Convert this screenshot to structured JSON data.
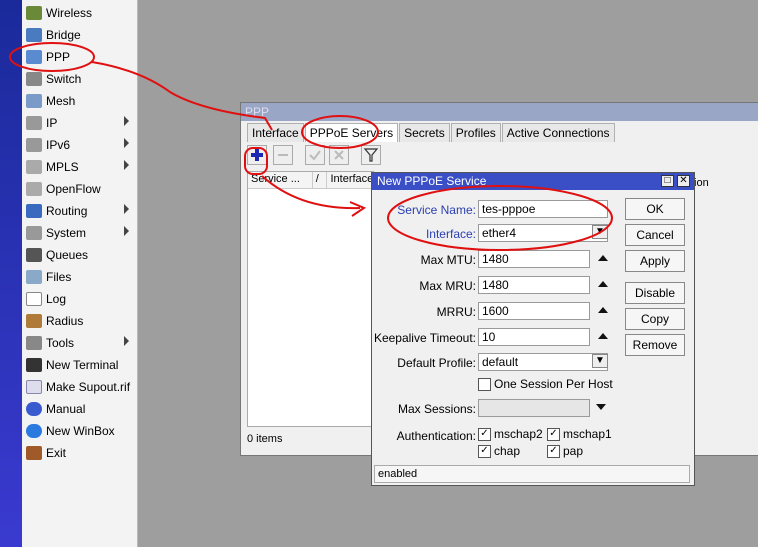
{
  "sidebar": {
    "items": [
      {
        "label": "Wireless",
        "icon": "wireless-icon"
      },
      {
        "label": "Bridge",
        "icon": "bridge-icon"
      },
      {
        "label": "PPP",
        "icon": "ppp-icon"
      },
      {
        "label": "Switch",
        "icon": "switch-icon"
      },
      {
        "label": "Mesh",
        "icon": "mesh-icon"
      },
      {
        "label": "IP",
        "icon": "ip-icon"
      },
      {
        "label": "IPv6",
        "icon": "ipv6-icon"
      },
      {
        "label": "MPLS",
        "icon": "mpls-icon"
      },
      {
        "label": "OpenFlow",
        "icon": "openflow-icon"
      },
      {
        "label": "Routing",
        "icon": "routing-icon"
      },
      {
        "label": "System",
        "icon": "system-icon"
      },
      {
        "label": "Queues",
        "icon": "queues-icon"
      },
      {
        "label": "Files",
        "icon": "files-icon"
      },
      {
        "label": "Log",
        "icon": "log-icon"
      },
      {
        "label": "Radius",
        "icon": "radius-icon"
      },
      {
        "label": "Tools",
        "icon": "tools-icon"
      },
      {
        "label": "New Terminal",
        "icon": "terminal-icon"
      },
      {
        "label": "Make Supout.rif",
        "icon": "supout-icon"
      },
      {
        "label": "Manual",
        "icon": "manual-icon"
      },
      {
        "label": "New WinBox",
        "icon": "winbox-icon"
      },
      {
        "label": "Exit",
        "icon": "exit-icon"
      }
    ]
  },
  "ppp_window": {
    "title": "PPP",
    "tabs": [
      "Interface",
      "PPPoE Servers",
      "Secrets",
      "Profiles",
      "Active Connections"
    ],
    "columns": [
      "Service ...",
      "/",
      "Interface"
    ],
    "count": "0 items",
    "partial_column": "tion"
  },
  "dialog": {
    "title": "New PPPoE Service",
    "fields": {
      "service_name": {
        "label": "Service Name:",
        "value": "tes-pppoe"
      },
      "interface": {
        "label": "Interface:",
        "value": "ether4"
      },
      "max_mtu": {
        "label": "Max MTU:",
        "value": "1480"
      },
      "max_mru": {
        "label": "Max MRU:",
        "value": "1480"
      },
      "mrru": {
        "label": "MRRU:",
        "value": "1600"
      },
      "keepalive": {
        "label": "Keepalive Timeout:",
        "value": "10"
      },
      "default_profile": {
        "label": "Default Profile:",
        "value": "default"
      },
      "one_session": {
        "label": "One Session Per Host"
      },
      "max_sessions": {
        "label": "Max Sessions:",
        "value": ""
      },
      "authentication": {
        "label": "Authentication:",
        "options": [
          "mschap2",
          "mschap1",
          "chap",
          "pap"
        ]
      }
    },
    "buttons": [
      "OK",
      "Cancel",
      "Apply",
      "Disable",
      "Copy",
      "Remove"
    ],
    "status": "enabled"
  },
  "colors": {
    "annotation": "#e01010",
    "menu_strip": "#2a3aba",
    "dialog_title": "#3a4fc6"
  }
}
